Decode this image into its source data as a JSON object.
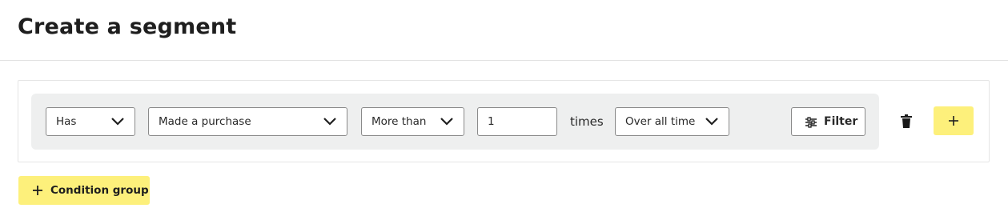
{
  "page": {
    "title": "Create a segment"
  },
  "condition": {
    "has_select": {
      "value": "Has"
    },
    "event_select": {
      "value": "Made a purchase"
    },
    "comparison_select": {
      "value": "More than"
    },
    "count_input": {
      "value": "1"
    },
    "times_label": "times",
    "timeframe_select": {
      "value": "Over all time"
    },
    "filter_button": {
      "label": "Filter",
      "icon": "filter-sliders-icon"
    },
    "delete_icon": "trash-icon",
    "add_button": {
      "icon": "plus-icon"
    }
  },
  "actions": {
    "condition_group_button": {
      "label": "Condition group",
      "icon": "plus-icon"
    }
  },
  "colors": {
    "accent_yellow": "#fdf07b",
    "row_background": "#eeefef",
    "border": "#8a8a8a"
  }
}
